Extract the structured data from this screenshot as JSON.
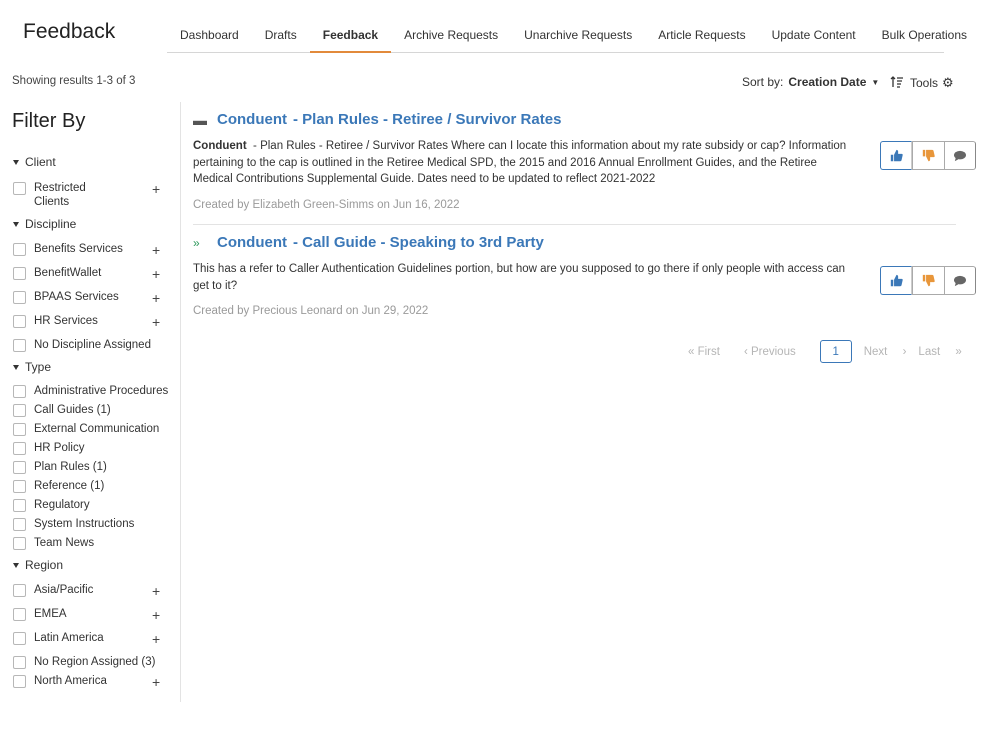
{
  "header": {
    "app_title": "Feedback",
    "tabs": [
      "Dashboard",
      "Drafts",
      "Feedback",
      "Archive Requests",
      "Unarchive Requests",
      "Article Requests",
      "Update Content",
      "Bulk Operations"
    ],
    "active_tab": "Feedback"
  },
  "toolbar": {
    "results_text": "Showing results 1-3 of 3",
    "sort_label": "Sort by:",
    "sort_value": "Creation Date",
    "tools_label": "Tools"
  },
  "filters": {
    "title": "Filter By",
    "groups": [
      {
        "label": "Client",
        "options": [
          {
            "label": "Restricted Clients",
            "expandable": true
          }
        ]
      },
      {
        "label": "Discipline",
        "options": [
          {
            "label": "Benefits Services",
            "expandable": true
          },
          {
            "label": "BenefitWallet",
            "expandable": true
          },
          {
            "label": "BPAAS Services",
            "expandable": true
          },
          {
            "label": "HR Services",
            "expandable": true
          },
          {
            "label": "No Discipline Assigned",
            "expandable": false
          }
        ]
      },
      {
        "label": "Type",
        "options": [
          {
            "label": "Administrative Procedures",
            "expandable": false
          },
          {
            "label": "Call Guides (1)",
            "expandable": false
          },
          {
            "label": "External Communication",
            "expandable": false
          },
          {
            "label": "HR Policy",
            "expandable": false
          },
          {
            "label": "Plan Rules (1)",
            "expandable": false
          },
          {
            "label": "Reference (1)",
            "expandable": false
          },
          {
            "label": "Regulatory",
            "expandable": false
          },
          {
            "label": "System Instructions",
            "expandable": false
          },
          {
            "label": "Team News",
            "expandable": false
          }
        ]
      },
      {
        "label": "Region",
        "options": [
          {
            "label": "Asia/Pacific",
            "expandable": true
          },
          {
            "label": "EMEA",
            "expandable": true
          },
          {
            "label": "Latin America",
            "expandable": true
          },
          {
            "label": "No Region Assigned (3)",
            "expandable": false
          },
          {
            "label": "North America",
            "expandable": true
          }
        ]
      }
    ]
  },
  "items": [
    {
      "client": "Conduent",
      "title": "- Plan Rules - Retiree / Survivor Rates",
      "toggle": "collapse",
      "body_client": "Conduent",
      "body": "- Plan Rules - Retiree / Survivor Rates Where can I locate this information about my rate subsidy or cap? Information pertaining to the cap is outlined in the Retiree Medical SPD, the 2015 and 2016 Annual Enrollment Guides, and the Retiree Medical Contributions Supplemental Guide. Dates need to be updated to reflect 2021-2022",
      "meta": "Created by Elizabeth Green-Simms on Jun 16, 2022"
    },
    {
      "client": "Conduent",
      "title": "- Call Guide - Speaking to 3rd Party",
      "toggle": "expand",
      "body": "This has a refer to Caller Authentication Guidelines portion, but how are you supposed to go there if only people with access can get to it?",
      "meta": "Created by Precious Leonard on Jun 29, 2022"
    }
  ],
  "pagination": {
    "first": "First",
    "previous": "Previous",
    "current": "1",
    "next": "Next",
    "last": "Last"
  },
  "colors": {
    "accent": "#3b78b8",
    "active_tab": "#e28a3b",
    "thumbs_down": "#e8963a",
    "expand": "#2f9a5d"
  }
}
